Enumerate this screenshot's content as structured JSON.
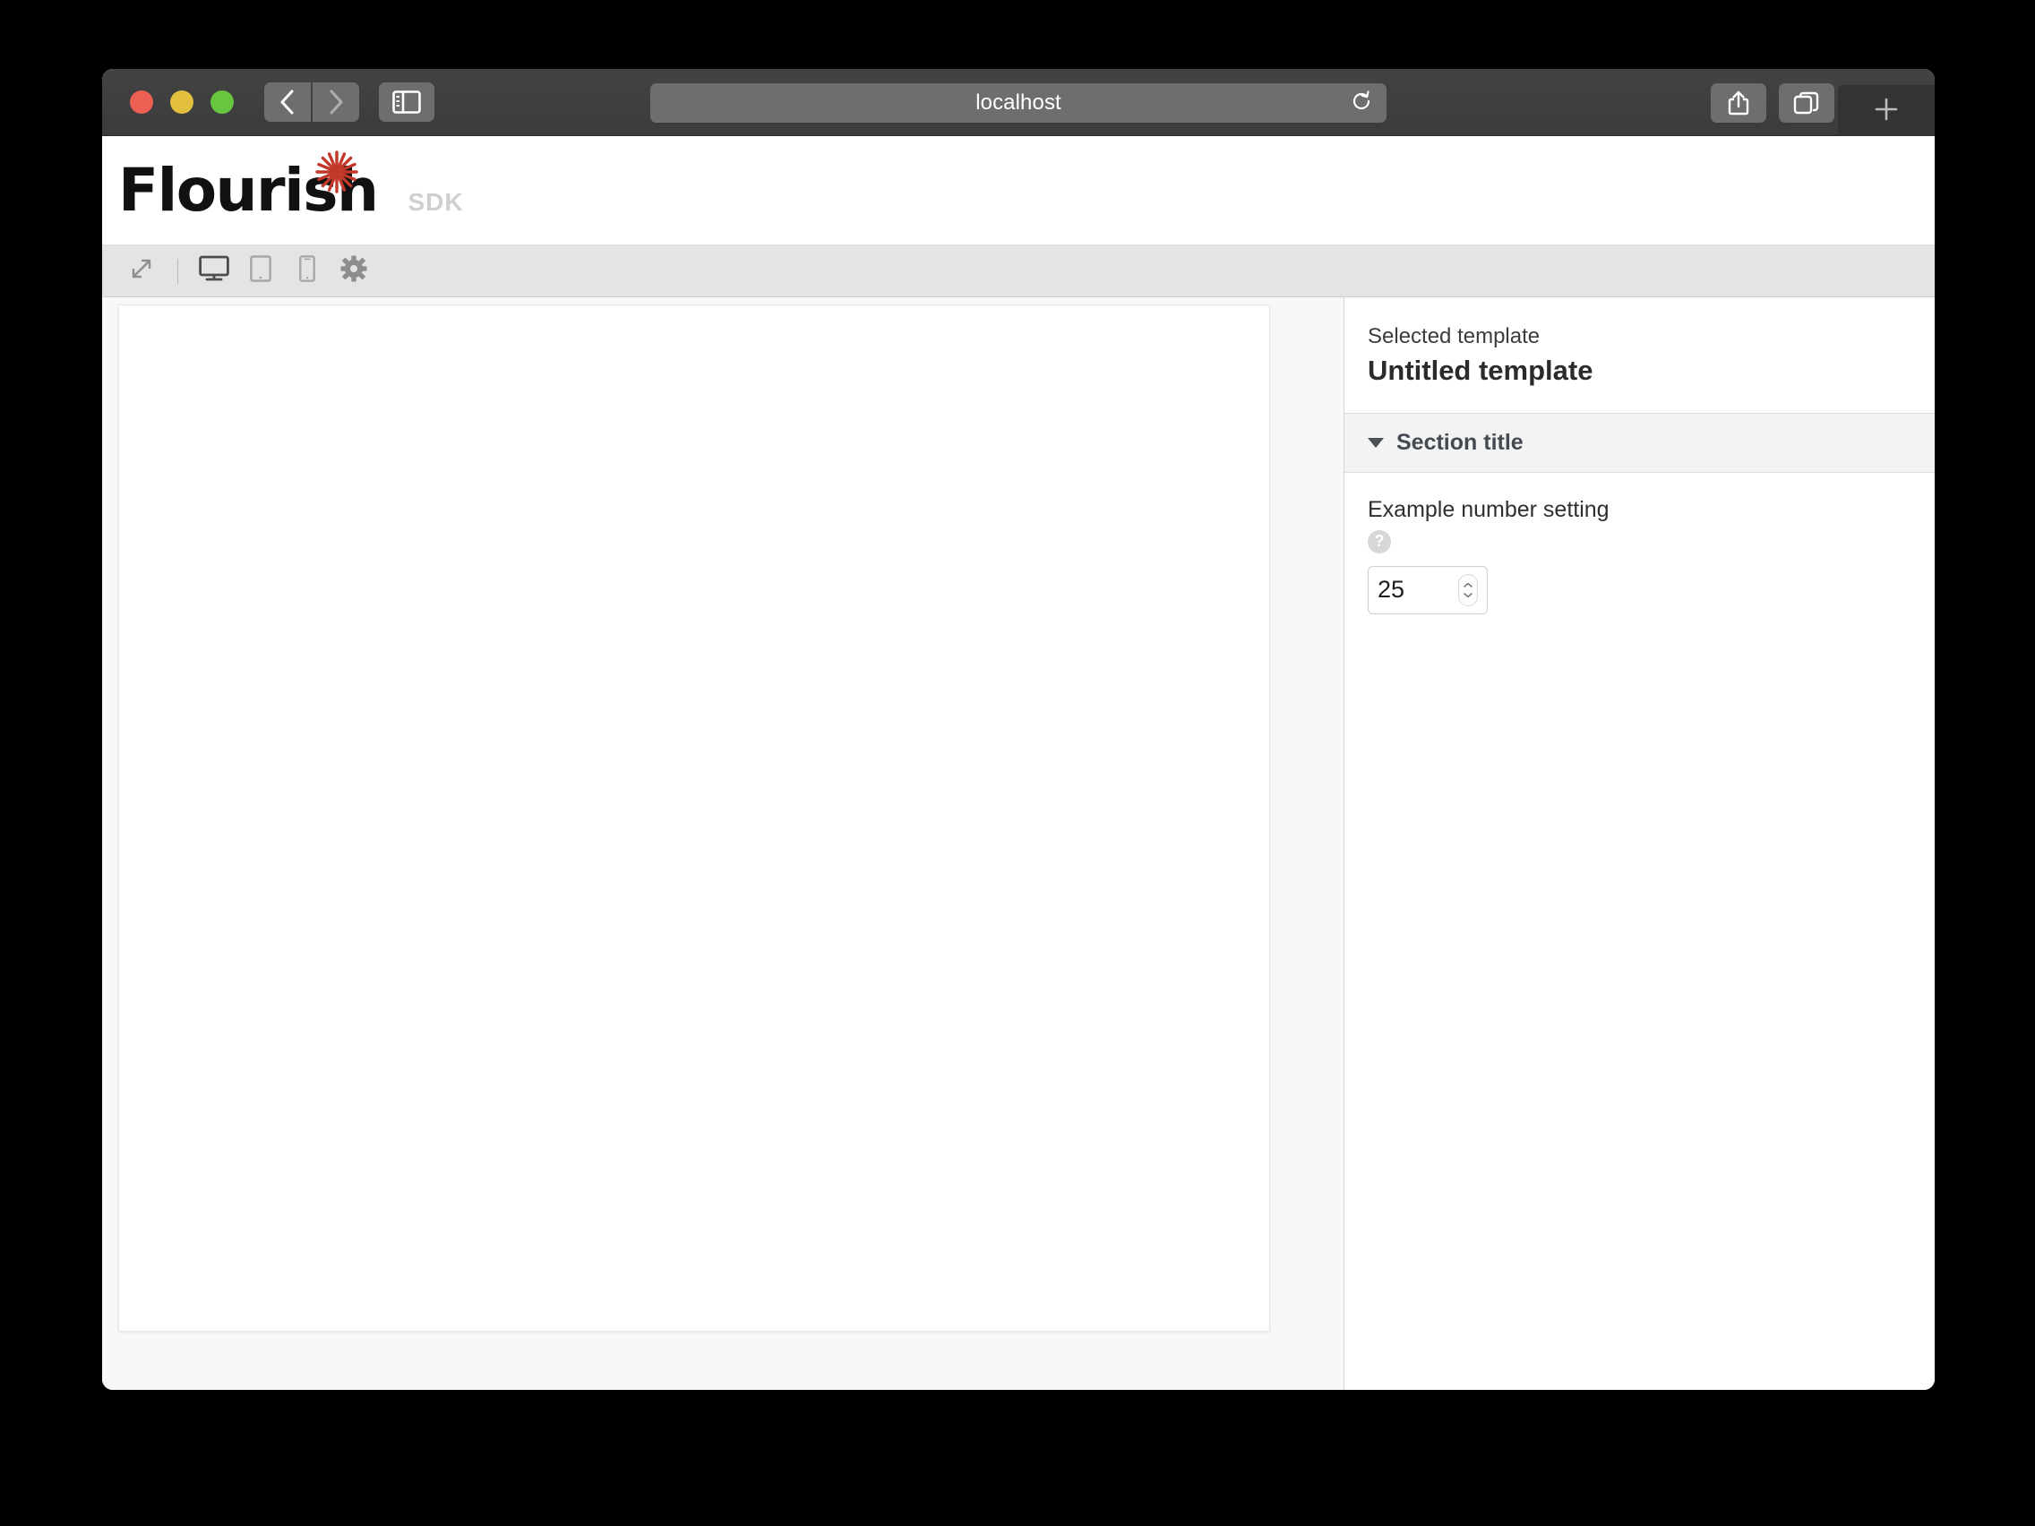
{
  "browser": {
    "address": "localhost",
    "traffic_lights": [
      "close",
      "minimize",
      "maximize"
    ],
    "back_label": "Back",
    "forward_label": "Forward",
    "sidebar_label": "Show sidebar",
    "reload_label": "Reload",
    "share_label": "Share",
    "tabs_label": "Show tab overview",
    "newtab_label": "+"
  },
  "brand": {
    "name": "Flourish",
    "suffix": "SDK"
  },
  "toolbar": {
    "items": [
      {
        "name": "expand",
        "label": "Fullscreen",
        "active": false
      },
      {
        "name": "desktop",
        "label": "Desktop preview",
        "active": true
      },
      {
        "name": "tablet",
        "label": "Tablet preview",
        "active": false
      },
      {
        "name": "mobile",
        "label": "Mobile preview",
        "active": false
      },
      {
        "name": "settings",
        "label": "Settings",
        "active": false
      }
    ]
  },
  "panel": {
    "eyebrow": "Selected template",
    "title": "Untitled template",
    "section": {
      "title": "Section title",
      "expanded": true,
      "settings": [
        {
          "label": "Example number setting",
          "help": "?",
          "type": "number",
          "value": "25"
        }
      ]
    }
  },
  "colors": {
    "accent_red": "#c0392b",
    "chrome": "#3d3d3d",
    "toolstrip": "#e4e4e4",
    "section_bg": "#f3f3f3"
  }
}
